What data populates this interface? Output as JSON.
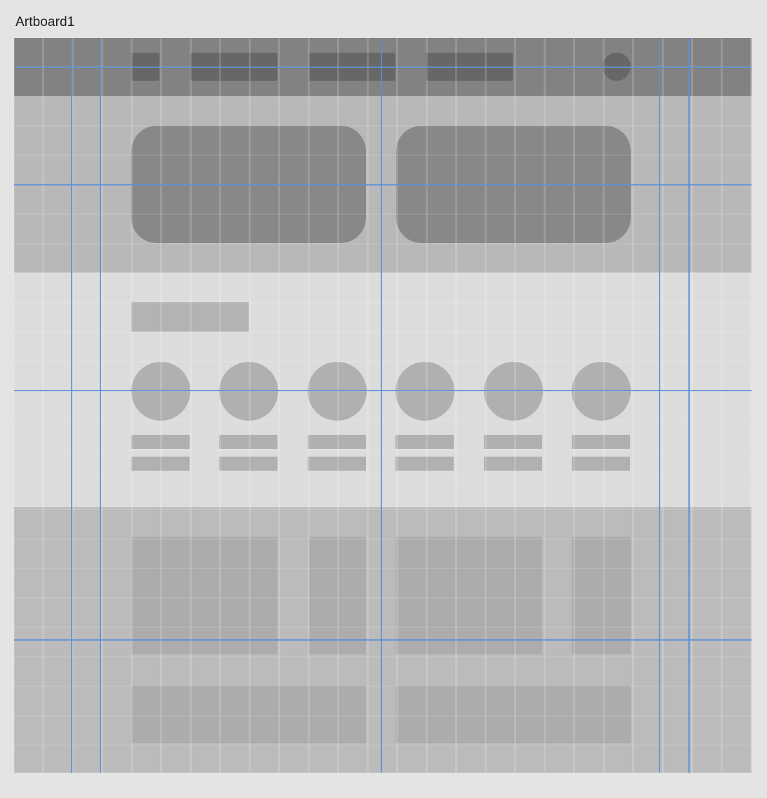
{
  "artboard": {
    "label": "Artboard1"
  },
  "colors": {
    "canvas": "#e4e4e4",
    "nav_band": "#828282",
    "hero_band": "#b8b8b8",
    "features_band": "#dcdcdc",
    "footer_band": "#bbbbbb",
    "guide_line": "#5b8fd8"
  },
  "wireframe": {
    "nav_item_count": 4,
    "hero_card_count": 2,
    "feature_count": 6,
    "footer_column_count": 4,
    "footer_wide_block_count": 2
  },
  "guides": {
    "vertical_count": 5,
    "horizontal_count": 4
  }
}
